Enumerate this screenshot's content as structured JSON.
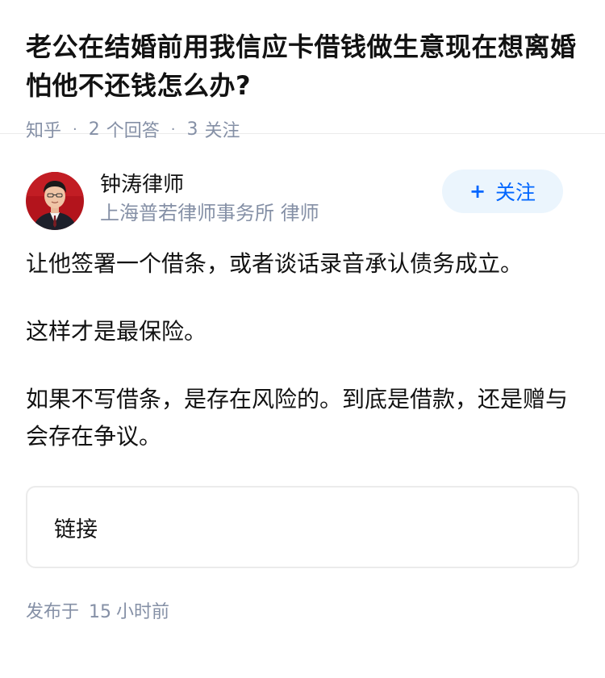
{
  "question": {
    "title": "老公在结婚前用我信应卡借钱做生意现在想离婚怕他不还钱怎么办?",
    "source": "知乎",
    "answer_count": "2",
    "answer_label": "个回答",
    "follow_count": "3",
    "follow_label": "关注"
  },
  "author": {
    "name": "钟涛律师",
    "bio": "上海普若律师事务所 律师",
    "follow_button": "关注"
  },
  "answer": {
    "paragraphs": [
      "让他签署一个借条，或者谈话录音承认债务成立。",
      "这样才是最保险。",
      "如果不写借条，是存在风险的。到底是借款，还是赠与会存在争议。"
    ],
    "link_card": "链接",
    "publish_prefix": "发布于",
    "publish_num": "15",
    "publish_unit": "小时前"
  },
  "colors": {
    "accent": "#0066ff",
    "follow_bg": "#ebf5fd",
    "meta": "#8590a6"
  }
}
